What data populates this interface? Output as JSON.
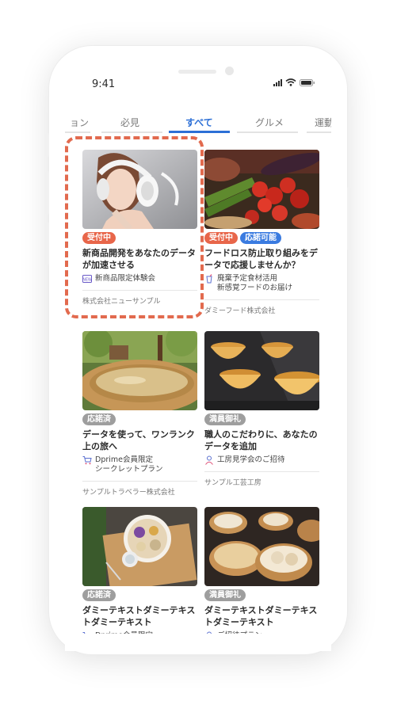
{
  "status": {
    "time": "9:41"
  },
  "tabs": [
    {
      "label": "ョン",
      "active": false
    },
    {
      "label": "必見",
      "active": false
    },
    {
      "label": "すべて",
      "active": true
    },
    {
      "label": "グルメ",
      "active": false
    },
    {
      "label": "運動",
      "active": false
    }
  ],
  "cards": [
    {
      "badges": [
        {
          "label": "受付中",
          "color": "orange"
        }
      ],
      "title": "新商品開発をあなたのデータが加速させる",
      "meta_icon": "sample-icon",
      "meta_text": "新商品限定体験会",
      "company": "株式会社ニューサンプル"
    },
    {
      "badges": [
        {
          "label": "受付中",
          "color": "orange"
        },
        {
          "label": "応諾可能",
          "color": "blue"
        }
      ],
      "title": "フードロス防止取り組みをデータで応援しませんか？",
      "meta_icon": "cup-icon",
      "meta_text": "廃棄予定食材活用\n新感覚フードのお届け",
      "company": "ダミーフード株式会社"
    },
    {
      "badges": [
        {
          "label": "応諾済",
          "color": "gray"
        }
      ],
      "title": "データを使って、ワンランク上の旅へ",
      "meta_icon": "cart-icon",
      "meta_text": "Dprime会員限定\nシークレットプラン",
      "company": "サンプルトラベラー株式会社"
    },
    {
      "badges": [
        {
          "label": "満員御礼",
          "color": "gray"
        }
      ],
      "title": "職人のこだわりに、あなたのデータを追加",
      "meta_icon": "person-icon",
      "meta_text": "工房見学会のご招待",
      "company": "サンプル工芸工房"
    },
    {
      "badges": [
        {
          "label": "応諾済",
          "color": "gray"
        }
      ],
      "title": "ダミーテキストダミーテキストダミーテキスト",
      "meta_icon": "cart-icon",
      "meta_text": "Dprime会員限定",
      "company": ""
    },
    {
      "badges": [
        {
          "label": "満員御礼",
          "color": "gray"
        }
      ],
      "title": "ダミーテキストダミーテキストダミーテキスト",
      "meta_icon": "person-icon",
      "meta_text": "ご招待プラン",
      "company": ""
    }
  ]
}
